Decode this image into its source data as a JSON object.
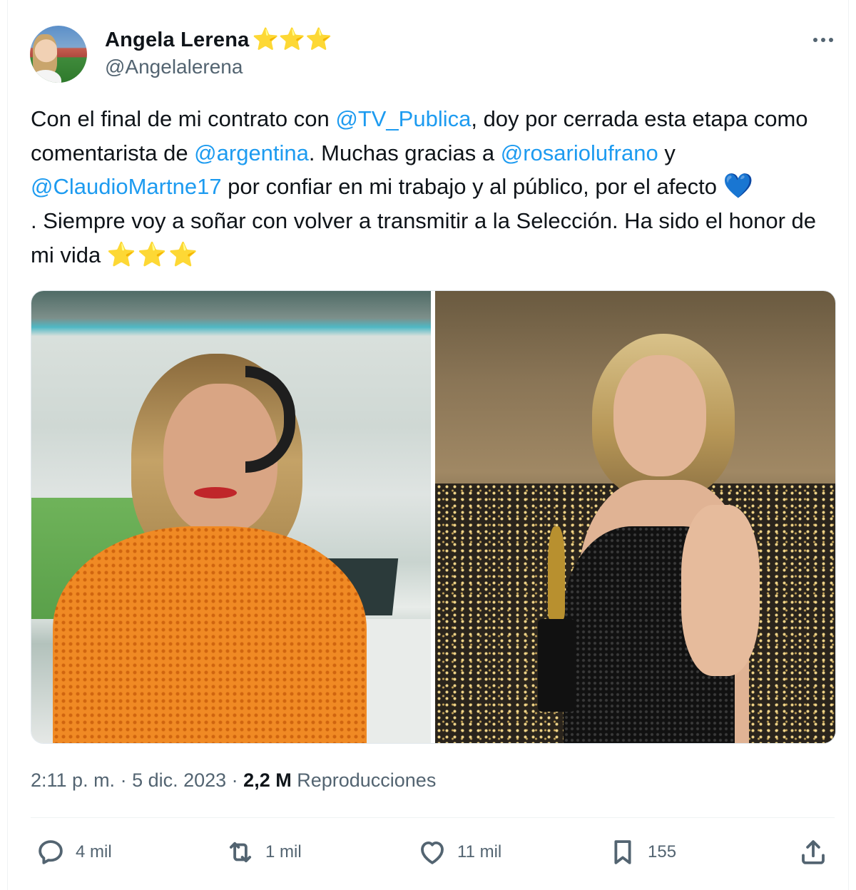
{
  "author": {
    "name": "Angela Lerena",
    "badge": "⭐⭐⭐",
    "handle": "@Angelalerena"
  },
  "tweet": {
    "t1": "Con el final de mi contrato con ",
    "m1": "@TV_Publica",
    "t2": ", doy por cerrada esta etapa como comentarista de ",
    "m2": "@argentina",
    "t3": ". Muchas gracias a ",
    "m3": "@rosariolufrano",
    "t4": " y ",
    "m4": "@ClaudioMartne17",
    "t5": " por confiar en mi trabajo y al público, por el afecto ",
    "emoji_heart": "💙",
    "t6": ". Siempre voy a soñar con volver a transmitir a la Selección. Ha sido el honor de mi vida ",
    "emoji_stars": "⭐⭐⭐"
  },
  "meta": {
    "time": "2:11 p. m.",
    "sep1": " · ",
    "date": "5 dic. 2023",
    "sep2": " · ",
    "views": "2,2 M",
    "views_label": " Reproducciones"
  },
  "actions": {
    "reply": "4 mil",
    "retweet": "1 mil",
    "like": "11 mil",
    "bookmark": "155"
  },
  "icons": {
    "more": "more-horizontal-icon",
    "reply": "reply-icon",
    "retweet": "retweet-icon",
    "like": "heart-icon",
    "bookmark": "bookmark-icon",
    "share": "share-icon"
  },
  "colors": {
    "mention": "#1d9bf0",
    "secondary_text": "#536471",
    "star": "#f7a92a"
  }
}
